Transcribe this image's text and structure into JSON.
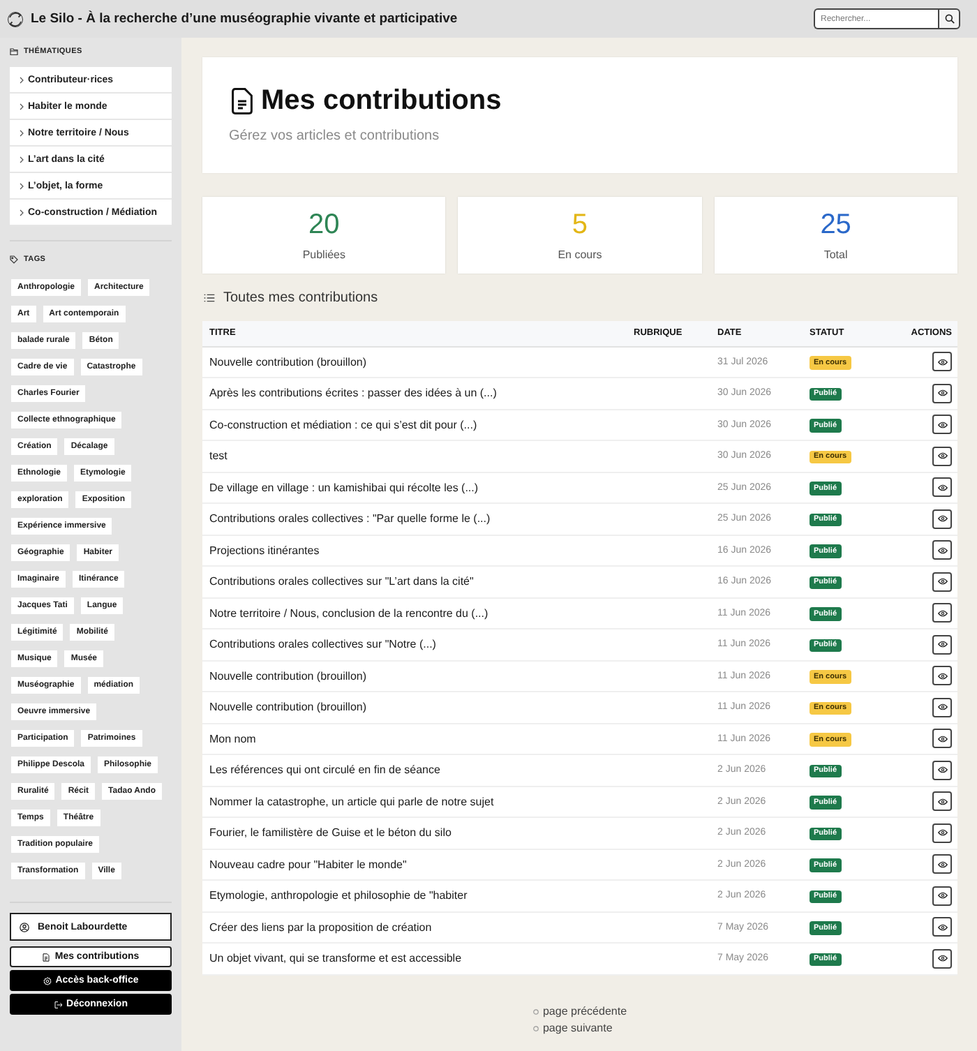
{
  "header": {
    "title": "Le Silo - À la recherche d’une muséographie vivante et participative",
    "search": {
      "placeholder": "Rechercher..."
    }
  },
  "sidebar": {
    "themes": {
      "title": "THÉMATIQUES",
      "items": [
        "Contributeur·rices",
        "Habiter le monde",
        "Notre territoire / Nous",
        "L’art dans la cité",
        "L’objet, la forme",
        "Co-construction / Médiation"
      ]
    },
    "tags": {
      "title": "TAGS",
      "items": [
        "Anthropologie",
        "Architecture",
        "Art",
        "Art contemporain",
        "balade rurale",
        "Béton",
        "Cadre de vie",
        "Catastrophe",
        "Charles Fourier",
        "Collecte ethnographique",
        "Création",
        "Décalage",
        "Ethnologie",
        "Etymologie",
        "exploration",
        "Exposition",
        "Expérience immersive",
        "Géographie",
        "Habiter",
        "Imaginaire",
        "Itinérance",
        "Jacques Tati",
        "Langue",
        "Légitimité",
        "Mobilité",
        "Musique",
        "Musée",
        "Muséographie",
        "médiation",
        "Oeuvre immersive",
        "Participation",
        "Patrimoines",
        "Philippe Descola",
        "Philosophie",
        "Ruralité",
        "Récit",
        "Tadao Ando",
        "Temps",
        "Théâtre",
        "Tradition populaire",
        "Transformation",
        "Ville"
      ]
    },
    "user": {
      "name": "Benoit Labourdette"
    },
    "buttons": [
      {
        "label": "Mes contributions",
        "kind": "page"
      },
      {
        "label": "Accès back-office",
        "kind": "admin"
      },
      {
        "label": "Déconnexion",
        "kind": "logout"
      }
    ]
  },
  "page": {
    "title": "Mes contributions",
    "subtitle": "Gérez vos articles et contributions"
  },
  "stats": [
    {
      "value": "20",
      "label": "Publiées",
      "color": "#2e8555"
    },
    {
      "value": "5",
      "label": "En cours",
      "color": "#e3b616"
    },
    {
      "value": "25",
      "label": "Total",
      "color": "#2a68c9"
    }
  ],
  "list": {
    "title": "Toutes mes contributions",
    "table": {
      "columns": [
        "TITRE",
        "RUBRIQUE",
        "DATE",
        "STATUT",
        "ACTIONS"
      ],
      "rows": [
        {
          "title": "Nouvelle contribution (brouillon)",
          "date": "31 Jul 2026",
          "status": {
            "label": "En cours",
            "kind": "pending"
          }
        },
        {
          "title": "Après les contributions écrites : passer des idées à un (...)",
          "date": "30 Jun 2026",
          "status": {
            "label": "Publié",
            "kind": "published"
          }
        },
        {
          "title": "Co-construction et médiation : ce qui s’est dit pour (...)",
          "date": "30 Jun 2026",
          "status": {
            "label": "Publié",
            "kind": "published"
          }
        },
        {
          "title": "test",
          "date": "30 Jun 2026",
          "status": {
            "label": "En cours",
            "kind": "pending"
          }
        },
        {
          "title": "De village en village : un kamishibai qui récolte les (...)",
          "date": "25 Jun 2026",
          "status": {
            "label": "Publié",
            "kind": "published"
          }
        },
        {
          "title": "Contributions orales collectives : \"Par quelle forme le (...)",
          "date": "25 Jun 2026",
          "status": {
            "label": "Publié",
            "kind": "published"
          }
        },
        {
          "title": "Projections itinérantes",
          "date": "16 Jun 2026",
          "status": {
            "label": "Publié",
            "kind": "published"
          }
        },
        {
          "title": "Contributions orales collectives sur \"L’art dans la cité\"",
          "date": "16 Jun 2026",
          "status": {
            "label": "Publié",
            "kind": "published"
          }
        },
        {
          "title": "Notre territoire / Nous, conclusion de la rencontre du (...)",
          "date": "11 Jun 2026",
          "status": {
            "label": "Publié",
            "kind": "published"
          }
        },
        {
          "title": "Contributions orales collectives sur \"Notre (...)",
          "date": "11 Jun 2026",
          "status": {
            "label": "Publié",
            "kind": "published"
          }
        },
        {
          "title": "Nouvelle contribution (brouillon)",
          "date": "11 Jun 2026",
          "status": {
            "label": "En cours",
            "kind": "pending"
          }
        },
        {
          "title": "Nouvelle contribution (brouillon)",
          "date": "11 Jun 2026",
          "status": {
            "label": "En cours",
            "kind": "pending"
          }
        },
        {
          "title": "Mon nom",
          "date": "11 Jun 2026",
          "status": {
            "label": "En cours",
            "kind": "pending"
          }
        },
        {
          "title": "Les références qui ont circulé en fin de séance",
          "date": "2 Jun 2026",
          "status": {
            "label": "Publié",
            "kind": "published"
          }
        },
        {
          "title": "Nommer la catastrophe, un article qui parle de notre sujet",
          "date": "2 Jun 2026",
          "status": {
            "label": "Publié",
            "kind": "published"
          }
        },
        {
          "title": "Fourier, le familistère de Guise et le béton du silo",
          "date": "2 Jun 2026",
          "status": {
            "label": "Publié",
            "kind": "published"
          }
        },
        {
          "title": "Nouveau cadre pour \"Habiter le monde\"",
          "date": "2 Jun 2026",
          "status": {
            "label": "Publié",
            "kind": "published"
          }
        },
        {
          "title": "Etymologie, anthropologie et philosophie de \"habiter",
          "date": "2 Jun 2026",
          "status": {
            "label": "Publié",
            "kind": "published"
          }
        },
        {
          "title": "Créer des liens par la proposition de création",
          "date": "7 May 2026",
          "status": {
            "label": "Publié",
            "kind": "published"
          }
        },
        {
          "title": "Un objet vivant, qui se transforme et est accessible",
          "date": "7 May 2026",
          "status": {
            "label": "Publié",
            "kind": "published"
          }
        }
      ]
    }
  },
  "pagination": [
    "page précédente",
    "page suivante"
  ]
}
